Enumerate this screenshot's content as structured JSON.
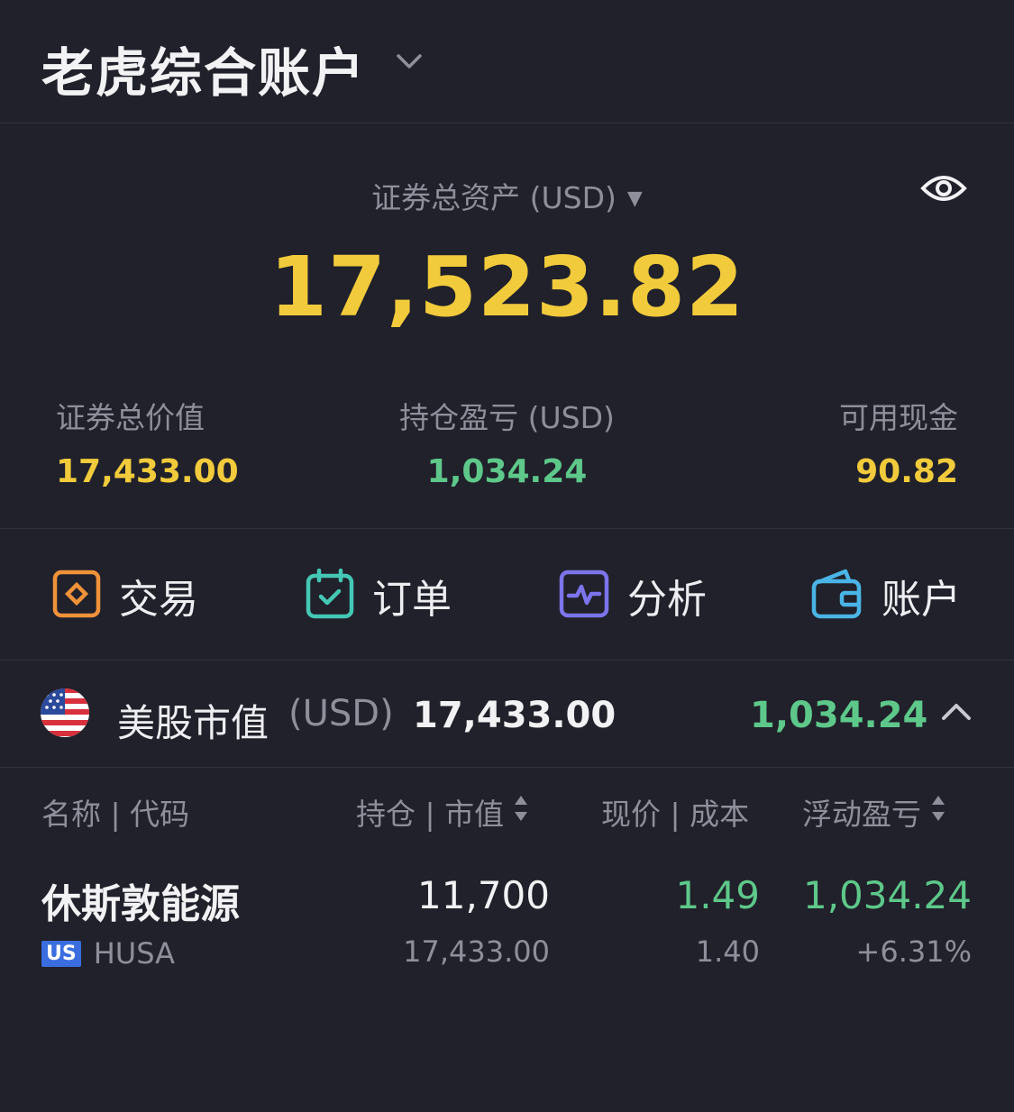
{
  "header": {
    "title": "老虎综合账户"
  },
  "summary": {
    "total_label": "证券总资产 (USD)",
    "total_value": "17,523.82",
    "stats": [
      {
        "label": "证券总价值",
        "value": "17,433.00"
      },
      {
        "label": "持仓盈亏 (USD)",
        "value": "1,034.24"
      },
      {
        "label": "可用现金",
        "value": "90.82"
      }
    ]
  },
  "actions": [
    {
      "label": "交易",
      "icon": "trade-icon"
    },
    {
      "label": "订单",
      "icon": "calendar-check-icon"
    },
    {
      "label": "分析",
      "icon": "chart-pulse-icon"
    },
    {
      "label": "账户",
      "icon": "wallet-icon"
    }
  ],
  "market": {
    "name": "美股市值",
    "unit": "(USD)",
    "value": "17,433.00",
    "pnl": "1,034.24"
  },
  "columns": {
    "name_code": "名称 | 代码",
    "position_value": "持仓 | 市值",
    "price_cost": "现价 | 成本",
    "float_pnl": "浮动盈亏"
  },
  "holding": {
    "name": "休斯敦能源",
    "market_badge": "US",
    "ticker": "HUSA",
    "quantity": "11,700",
    "market_value": "17,433.00",
    "price": "1.49",
    "cost": "1.40",
    "pnl": "1,034.24",
    "pnl_pct": "+6.31%"
  },
  "colors": {
    "background": "#20212a",
    "gold": "#f2cb3c",
    "green": "#5ec88a",
    "muted": "#8e8f9b"
  }
}
